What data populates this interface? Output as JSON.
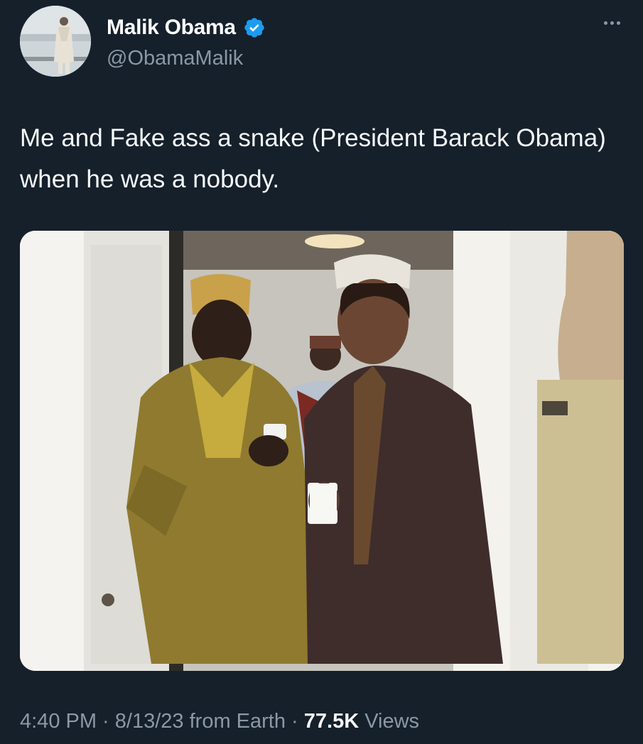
{
  "author": {
    "display_name": "Malik Obama",
    "handle": "@ObamaMalik",
    "verified": true
  },
  "tweet": {
    "text": "Me and Fake ass a snake (President Barack Obama) when he was a nobody."
  },
  "meta": {
    "time": "4:40 PM",
    "separator_1": " · ",
    "date": "8/13/23",
    "source": " from Earth",
    "separator_2": " · ",
    "views_count": "77.5K",
    "views_label": " Views"
  },
  "colors": {
    "background": "#15202b",
    "secondary_text": "#8b98a5",
    "verified_badge": "#1d9bf0"
  },
  "icons": {
    "verified": "verified-badge-icon",
    "more": "more-options-icon"
  }
}
